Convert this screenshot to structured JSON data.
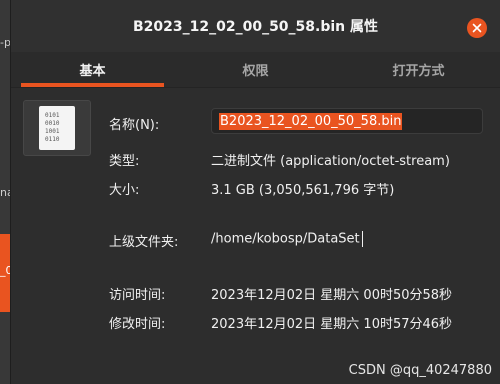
{
  "background": {
    "frag1": "-p",
    "frag2": "na",
    "frag3": "_0"
  },
  "window": {
    "title": "B2023_12_02_00_50_58.bin 属性",
    "close_icon": "close-icon"
  },
  "tabs": [
    {
      "label": "基本",
      "active": true
    },
    {
      "label": "权限",
      "active": false
    },
    {
      "label": "打开方式",
      "active": false
    }
  ],
  "file_icon": {
    "name": "binary-file-icon",
    "lines": [
      "0101",
      "0010",
      "1001",
      "0110"
    ]
  },
  "properties": {
    "name_label": "名称(N):",
    "name_value": "B2023_12_02_00_50_58.bin",
    "type_label": "类型:",
    "type_value": "二进制文件 (application/octet-stream)",
    "size_label": "大小:",
    "size_value": "3.1 GB (3,050,561,796 字节)",
    "parent_label": "上级文件夹:",
    "parent_value": "/home/kobosp/DataSet",
    "accessed_label": "访问时间:",
    "accessed_value": "2023年12月02日 星期六 00时50分58秒",
    "modified_label": "修改时间:",
    "modified_value": "2023年12月02日 星期六 10时57分46秒"
  },
  "watermark": "CSDN @qq_40247880",
  "colors": {
    "accent": "#e95420",
    "background": "#2d2d2d"
  }
}
